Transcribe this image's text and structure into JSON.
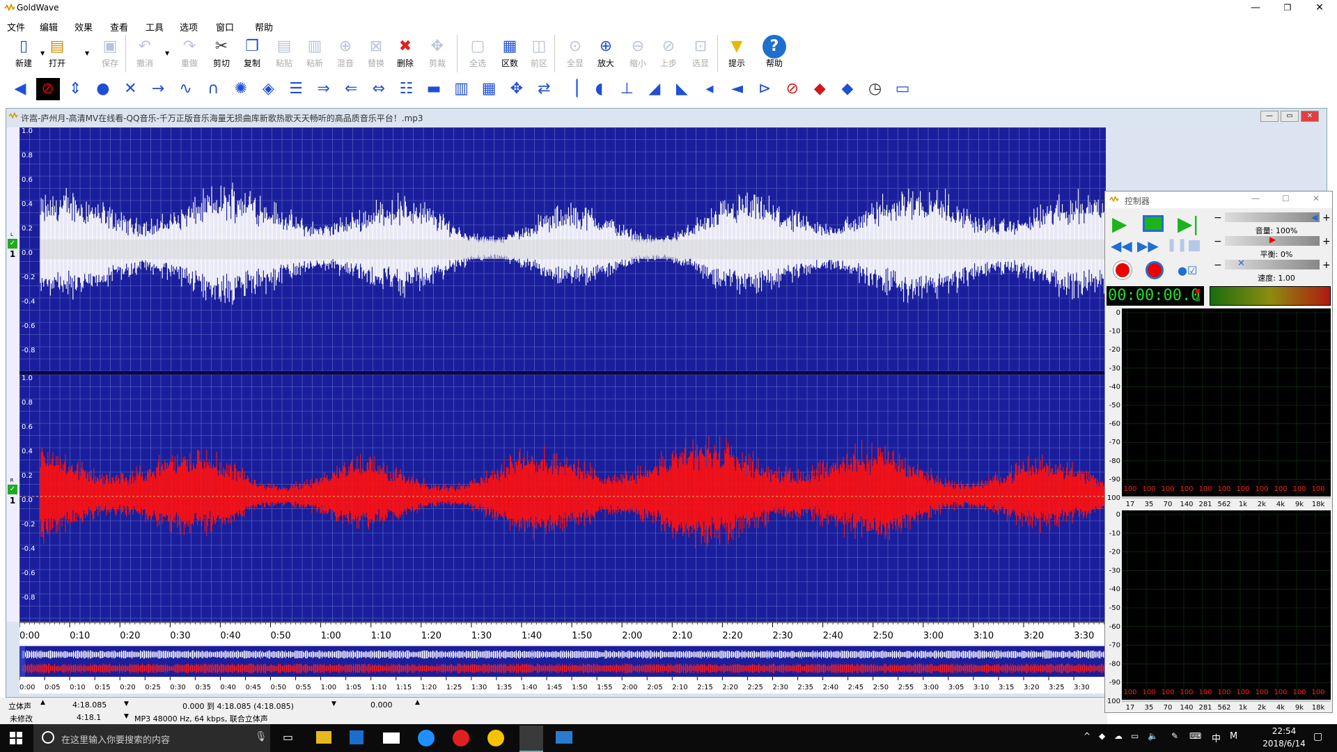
{
  "window": {
    "title": "GoldWave",
    "controls": [
      "—",
      "❐",
      "✕"
    ]
  },
  "menu": [
    "文件",
    "编辑",
    "效果",
    "查看",
    "工具",
    "选项",
    "窗口",
    "帮助"
  ],
  "toolbar": [
    {
      "label": "新建",
      "icon": "new-file-icon",
      "enabled": true
    },
    {
      "label": "打开",
      "icon": "open-folder-icon",
      "enabled": true
    },
    {
      "label": "保存",
      "icon": "save-icon",
      "enabled": false
    },
    {
      "label": "撤消",
      "icon": "undo-icon",
      "enabled": false
    },
    {
      "label": "重做",
      "icon": "redo-icon",
      "enabled": false
    },
    {
      "label": "剪切",
      "icon": "scissors-icon",
      "enabled": true
    },
    {
      "label": "复制",
      "icon": "copy-icon",
      "enabled": true
    },
    {
      "label": "粘贴",
      "icon": "paste-icon",
      "enabled": false
    },
    {
      "label": "粘新",
      "icon": "paste-new-icon",
      "enabled": false
    },
    {
      "label": "混音",
      "icon": "mix-icon",
      "enabled": false
    },
    {
      "label": "替换",
      "icon": "replace-icon",
      "enabled": false
    },
    {
      "label": "删除",
      "icon": "delete-icon",
      "enabled": true
    },
    {
      "label": "剪裁",
      "icon": "trim-icon",
      "enabled": false
    },
    {
      "label": "全选",
      "icon": "select-all-icon",
      "enabled": false
    },
    {
      "label": "区数",
      "icon": "cue-icon",
      "enabled": true
    },
    {
      "label": "前区",
      "icon": "previous-cue-icon",
      "enabled": false
    },
    {
      "label": "全显",
      "icon": "zoom-all-icon",
      "enabled": false
    },
    {
      "label": "放大",
      "icon": "zoom-in-icon",
      "enabled": true
    },
    {
      "label": "缩小",
      "icon": "zoom-out-icon",
      "enabled": false
    },
    {
      "label": "上步",
      "icon": "zoom-previous-icon",
      "enabled": false
    },
    {
      "label": "选显",
      "icon": "zoom-selection-icon",
      "enabled": false
    },
    {
      "label": "提示",
      "icon": "tip-icon",
      "enabled": true
    },
    {
      "label": "帮助",
      "icon": "help-icon",
      "enabled": true
    }
  ],
  "effects_toolbar_icons": [
    "mute-left-icon",
    "stop-icon",
    "invert-icon",
    "doppler-icon",
    "mechanize-icon",
    "echo-icon",
    "flanger-icon",
    "pitch-icon",
    "reverb-icon",
    "volume-icon",
    "equalizer-icon",
    "fade-in-icon",
    "offset-icon",
    "pan-icon",
    "filter-icon",
    "band-icon",
    "spectrum-icon",
    "compress-icon",
    "expand-icon",
    "maximize-icon",
    "mark-start-icon",
    "speaker-icon",
    "marker-icon",
    "fade-out-icon",
    "shape-icon",
    "volume-change-icon",
    "volume-match-icon",
    "noise-icon",
    "pop-icon",
    "silence-icon",
    "clip-icon",
    "time-warp-icon",
    "repair-icon"
  ],
  "doc": {
    "title": "许嵩-庐州月-高清MV在线看-QQ音乐-千万正版音乐海量无损曲库新歌热歌天天畅听的高品质音乐平台！.mp3",
    "controls": [
      "—",
      "▭",
      "✕"
    ]
  },
  "wave": {
    "y_ticks": [
      "1.0",
      "0.8",
      "0.6",
      "0.4",
      "0.2",
      "0.0",
      "-0.2",
      "-0.4",
      "-0.6",
      "-0.8"
    ],
    "left_channel_label": "L",
    "right_channel_label": "R",
    "channel_number": "1",
    "colors": {
      "background": "#1b1e9c",
      "left": "#ffffff",
      "right": "#ff1010",
      "grid": "#5e74c4"
    }
  },
  "timeline": {
    "labels": [
      "0:00",
      "0:10",
      "0:20",
      "0:30",
      "0:40",
      "0:50",
      "1:00",
      "1:10",
      "1:20",
      "1:30",
      "1:40",
      "1:50",
      "2:00",
      "2:10",
      "2:20",
      "2:30",
      "2:40",
      "2:50",
      "3:00",
      "3:10",
      "3:20",
      "3:30"
    ]
  },
  "overview_timeline": {
    "labels": [
      "0:00",
      "0:05",
      "0:10",
      "0:15",
      "0:20",
      "0:25",
      "0:30",
      "0:35",
      "0:40",
      "0:45",
      "0:50",
      "0:55",
      "1:00",
      "1:05",
      "1:10",
      "1:15",
      "1:20",
      "1:25",
      "1:30",
      "1:35",
      "1:40",
      "1:45",
      "1:50",
      "1:55",
      "2:00",
      "2:05",
      "2:10",
      "2:15",
      "2:20",
      "2:25",
      "2:30",
      "2:35",
      "2:40",
      "2:45",
      "2:50",
      "2:55",
      "3:00",
      "3:05",
      "3:10",
      "3:15",
      "3:20",
      "3:25",
      "3:30"
    ]
  },
  "status": {
    "channels": "立体声",
    "length": "4:18.085",
    "selection": "0.000 到 4:18.085 (4:18.085)",
    "position": "0.000",
    "modified": "未修改",
    "length2": "4:18.1",
    "format": "MP3 48000 Hz, 64 kbps, 联合立体声"
  },
  "controller": {
    "title": "控制器",
    "controls": [
      "—",
      "☐",
      "✕"
    ],
    "volume_label": "音量: 100%",
    "balance_label": "平衡: 0%",
    "speed_label": "速度: 1.00",
    "time": "00:00:00.0",
    "volume": 1.0,
    "balance": 0,
    "speed": 1.0,
    "db_ticks": [
      "0",
      "-10",
      "-20",
      "-30",
      "-40",
      "-50",
      "-60",
      "-70",
      "-80",
      "-90",
      "-100"
    ],
    "freq_labels": [
      "17",
      "35",
      "70",
      "140",
      "281",
      "562",
      "1k",
      "2k",
      "4k",
      "9k",
      "18k"
    ],
    "peak_values": [
      "100",
      "100",
      "100",
      "100",
      "100",
      "100",
      "100",
      "100",
      "100",
      "100",
      "100"
    ]
  },
  "taskbar": {
    "search_placeholder": "在这里输入你要搜索的内容",
    "time": "22:54",
    "date": "2018/6/14",
    "ime": "中",
    "ime2": "M"
  }
}
